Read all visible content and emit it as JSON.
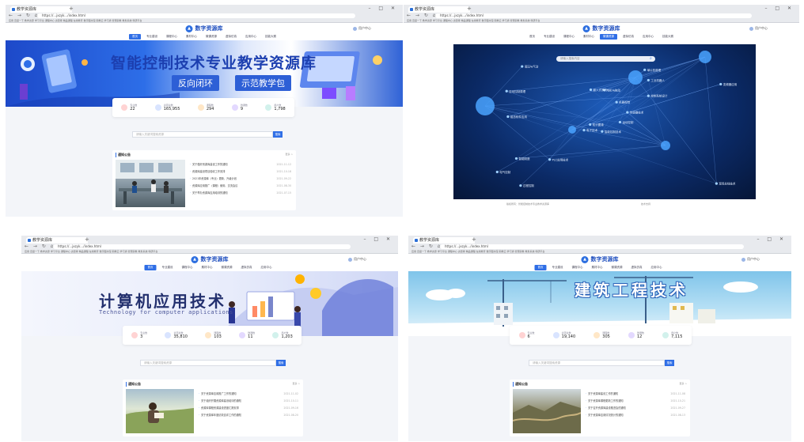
{
  "browser": {
    "tab_title": "教学资源库",
    "new_tab": "+",
    "window_controls": "– □ ✕",
    "nav": "← → ↻ ⌂",
    "address": "https://...jxzyk.../index.html",
    "bookmarks": "应用  百度一下  教学资源  学习平台  课程中心  资源库  精品课程  在线教育  数字图书馆  职教云  学习通  智慧职教  教务系统  科研平台"
  },
  "site": {
    "logo_text": "数字资源库",
    "user_label": "用户中心",
    "menu": [
      "首页",
      "专业建设",
      "课程中心",
      "素材中心",
      "微课资源",
      "虚拟仿真",
      "应用中心",
      "技能大赛"
    ]
  },
  "q1": {
    "banner_title": "智能控制技术专业教学资源库",
    "badge_left": "反向闭环",
    "badge_right": "示范教学包",
    "stats": [
      {
        "label": "专业数",
        "value": "22"
      },
      {
        "label": "资源总数",
        "value": "165,955"
      },
      {
        "label": "课程数",
        "value": "294"
      },
      {
        "label": "微课数",
        "value": "9"
      },
      {
        "label": "用户数",
        "value": "1,798"
      }
    ],
    "search_placeholder": "请输入关键词搜索资源",
    "search_button": "搜索",
    "news_title": "通知公告",
    "news_more": "更多 >",
    "news_items": [
      {
        "text": "关于做好资源库建设工作的通知",
        "date": "2021-11-12"
      },
      {
        "text": "资源库建设项目验收工作安排",
        "date": "2021-10-18"
      },
      {
        "text": "2021年资源库（专业）更新、升级计划",
        "date": "2021-09-22"
      },
      {
        "text": "资源库应用推广（课程）使用、交流会议",
        "date": "2021-08-30"
      },
      {
        "text": "关于举办资源库应用培训的通知",
        "date": "2021-07-15"
      }
    ]
  },
  "q2": {
    "search_placeholder": "请输入搜索内容",
    "footer_left": "版权所有：智能控制技术专业教学资源库",
    "footer_right": "技术支持",
    "nodes": [
      "智能控制技术",
      "自动控制原理",
      "知识图谱",
      "电气控制",
      "传感器技术",
      "PLC应用技术",
      "单片机原理",
      "电机与拖动",
      "工业机器人",
      "运动控制",
      "液压与气动",
      "现场总线技术",
      "组态软件应用",
      "变频器应用",
      "电子技术",
      "控制系统设计",
      "过程控制",
      "嵌入式系统",
      "机器视觉",
      "智能制造"
    ]
  },
  "q3": {
    "banner_title": "计算机应用技术",
    "banner_subtitle": "Technology for computer applications",
    "stats": [
      {
        "label": "专业数",
        "value": "3"
      },
      {
        "label": "资源总数",
        "value": "35,810"
      },
      {
        "label": "课程数",
        "value": "103"
      },
      {
        "label": "微课数",
        "value": "11"
      },
      {
        "label": "用户数",
        "value": "1,203"
      }
    ],
    "search_placeholder": "请输入关键词搜索资源",
    "search_button": "搜索",
    "news_title": "通知公告",
    "news_more": "更多 >",
    "news_items": [
      {
        "text": "关于资源库应用推广工作的通知",
        "date": "2021-11-02"
      },
      {
        "text": "关于组织开展资源库建设培训的通知",
        "date": "2021-10-11"
      },
      {
        "text": "资源库课程资源建设进度汇报安排",
        "date": "2021-09-16"
      },
      {
        "text": "关于资源库年度绩效自评工作的通知",
        "date": "2021-08-20"
      }
    ]
  },
  "q4": {
    "banner_title": "建筑工程技术",
    "stats": [
      {
        "label": "专业数",
        "value": "6"
      },
      {
        "label": "资源总数",
        "value": "19,140"
      },
      {
        "label": "课程数",
        "value": "305"
      },
      {
        "label": "微课数",
        "value": "12"
      },
      {
        "label": "用户数",
        "value": "7,115"
      }
    ],
    "search_placeholder": "请输入关键词搜索资源",
    "search_button": "搜索",
    "news_title": "通知公告",
    "news_more": "更多 >",
    "news_items": [
      {
        "text": "关于资源库建设工作的通知",
        "date": "2021-11-08"
      },
      {
        "text": "关于资源库课程更新工作的通知",
        "date": "2021-10-21"
      },
      {
        "text": "关于召开资源库建设推进会的通知",
        "date": "2021-09-27"
      },
      {
        "text": "关于资源库应用情况统计的通知",
        "date": "2021-08-13"
      }
    ]
  }
}
